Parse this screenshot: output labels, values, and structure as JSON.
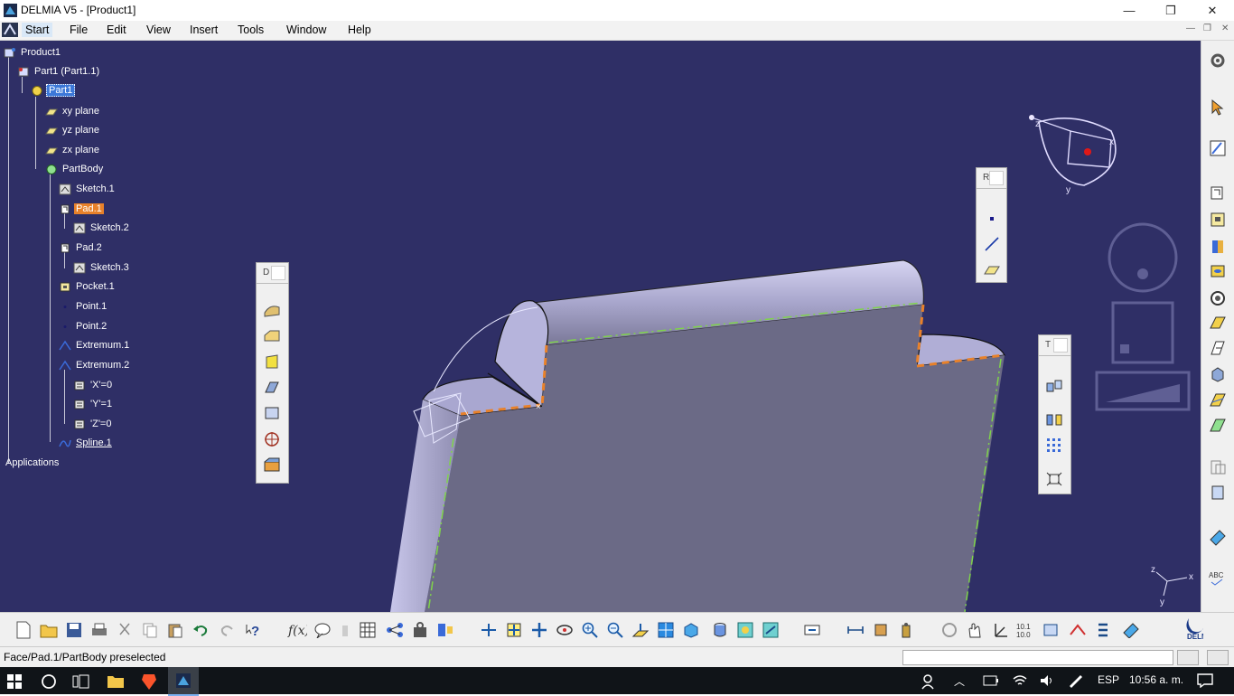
{
  "window": {
    "title": "DELMIA V5 - [Product1]",
    "controls": {
      "minimize": "—",
      "restore": "❐",
      "close": "✕"
    }
  },
  "menu": {
    "items": [
      "Start",
      "File",
      "Edit",
      "View",
      "Insert",
      "Tools",
      "Window",
      "Help"
    ]
  },
  "tree": {
    "root": "Product1",
    "part_instance": "Part1 (Part1.1)",
    "part": "Part1",
    "planes": [
      "xy plane",
      "yz plane",
      "zx plane"
    ],
    "body": "PartBody",
    "features": [
      "Sketch.1",
      "Pad.1",
      "Sketch.2",
      "Pad.2",
      "Sketch.3",
      "Pocket.1",
      "Point.1",
      "Point.2",
      "Extremum.1",
      "Extremum.2",
      "'X'=0",
      "'Y'=1",
      "'Z'=0",
      "Spline.1"
    ],
    "applications": "Applications"
  },
  "floating_toolbars": {
    "dress_up": {
      "header": "D"
    },
    "reference": {
      "header": "R"
    },
    "transform": {
      "header": "T"
    }
  },
  "compass": {
    "x_label": "x",
    "y_label": "y",
    "z_label": "z"
  },
  "axis_triad": {
    "x_label": "x",
    "y_label": "y",
    "z_label": "z"
  },
  "status": {
    "text": "Face/Pad.1/PartBody preselected"
  },
  "taskbar": {
    "language": "ESP",
    "time": "10:56 a. m."
  },
  "colors": {
    "viewport_bg": "#2f2f66",
    "part_surface": "#6b6a86",
    "part_edge": "#b8b6dc",
    "highlight": "#e8812a",
    "selection": "#3c78d8"
  },
  "icons": {
    "bottom_toolbar": [
      "new-icon",
      "open-icon",
      "save-icon",
      "print-icon",
      "cut-icon",
      "copy-icon",
      "paste-icon",
      "undo-icon",
      "redo-icon",
      "whats-this-icon",
      "formula-icon",
      "knowledge-icon",
      "grid-icon",
      "analysis-icon",
      "fit-all-icon",
      "pan-icon",
      "rotate-icon",
      "zoom-in-icon",
      "zoom-out-icon",
      "normal-view-icon",
      "views-icon",
      "render-style-icon",
      "measure-icon",
      "apply-material-icon"
    ]
  }
}
